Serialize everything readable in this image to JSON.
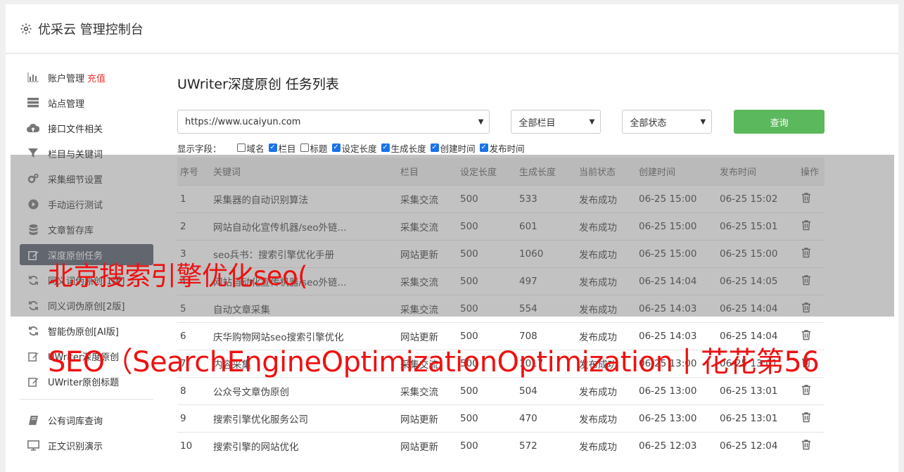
{
  "header": {
    "title": "优采云 管理控制台",
    "icon": "gear-icon"
  },
  "sidebar": {
    "items": [
      {
        "label": "账户管理",
        "extra": "充值",
        "icon": "bar-chart-icon"
      },
      {
        "label": "站点管理",
        "icon": "server-icon"
      },
      {
        "label": "接口文件相关",
        "icon": "cloud-upload-icon"
      },
      {
        "label": "栏目与关键词",
        "icon": "filter-icon"
      },
      {
        "label": "采集细节设置",
        "icon": "gears-icon"
      },
      {
        "label": "手动运行测试",
        "icon": "play-circle-icon"
      },
      {
        "label": "文章暂存库",
        "icon": "database-icon"
      },
      {
        "label": "深度原创任务",
        "icon": "edit-icon",
        "active": true
      },
      {
        "label": "同义词伪原创[1版]",
        "icon": "refresh-icon"
      },
      {
        "label": "同义词伪原创[2版]",
        "icon": "refresh-icon"
      },
      {
        "label": "智能伪原创[AI版]",
        "icon": "refresh-icon"
      },
      {
        "label": "UWriter深度原创",
        "icon": "edit-icon"
      },
      {
        "label": "UWriter原创标题",
        "icon": "edit-icon"
      }
    ],
    "items2": [
      {
        "label": "公有词库查询",
        "icon": "book-icon"
      },
      {
        "label": "正文识别演示",
        "icon": "monitor-icon"
      }
    ]
  },
  "main": {
    "title": "UWriter深度原创 任务列表",
    "site_select": "https://www.ucaiyun.com",
    "column_select": "全部栏目",
    "status_select": "全部状态",
    "query_label": "查询",
    "fields_label": "显示字段：",
    "fields": [
      {
        "label": "域名",
        "checked": false
      },
      {
        "label": "栏目",
        "checked": true
      },
      {
        "label": "标题",
        "checked": false
      },
      {
        "label": "设定长度",
        "checked": true
      },
      {
        "label": "生成长度",
        "checked": true
      },
      {
        "label": "创建时间",
        "checked": true
      },
      {
        "label": "发布时间",
        "checked": true
      }
    ],
    "columns": [
      "序号",
      "关键词",
      "栏目",
      "设定长度",
      "生成长度",
      "当前状态",
      "创建时间",
      "发布时间",
      "操作"
    ],
    "rows": [
      [
        "1",
        "采集器的自动识别算法",
        "采集交流",
        "500",
        "533",
        "发布成功",
        "06-25 15:00",
        "06-25 15:02"
      ],
      [
        "2",
        "网站自动化宣传机器/seo外链...",
        "采集交流",
        "500",
        "601",
        "发布成功",
        "06-25 15:00",
        "06-25 15:01"
      ],
      [
        "3",
        "seo兵书：搜索引擎优化手册",
        "网站更新",
        "500",
        "1060",
        "发布成功",
        "06-25 15:00",
        "06-25 15:00"
      ],
      [
        "4",
        "网站自动化宣传机器/seo外链...",
        "采集交流",
        "500",
        "497",
        "发布成功",
        "06-25 14:04",
        "06-25 14:05"
      ],
      [
        "5",
        "自动文章采集",
        "采集交流",
        "500",
        "554",
        "发布成功",
        "06-25 14:03",
        "06-25 14:04"
      ],
      [
        "6",
        "庆华购物网站seo搜索引擎优化",
        "网站更新",
        "500",
        "708",
        "发布成功",
        "06-25 14:03",
        "06-25 14:04"
      ],
      [
        "7",
        "内容采集",
        "采集交流",
        "500",
        "1017",
        "发布成功",
        "06-25 13:00",
        "06-25 13:01"
      ],
      [
        "8",
        "公众号文章伪原创",
        "采集交流",
        "500",
        "504",
        "发布成功",
        "06-25 13:00",
        "06-25 13:01"
      ],
      [
        "9",
        "搜索引擎优化服务公司",
        "网站更新",
        "500",
        "470",
        "发布成功",
        "06-25 13:00",
        "06-25 13:01"
      ],
      [
        "10",
        "搜索引擎的网站优化",
        "网站更新",
        "500",
        "572",
        "发布成功",
        "06-25 12:03",
        "06-25 12:04"
      ]
    ]
  },
  "watermark": {
    "line1": "北京搜索引擎优化seo(",
    "line2": "SEO（SearchEngineOptimizationOptimization丨花花第56"
  },
  "colors": {
    "accent_green": "#5cb85c",
    "status_green": "#2e9e2e",
    "watermark_red": "#ee1111",
    "active_bg": "#5a6170"
  }
}
